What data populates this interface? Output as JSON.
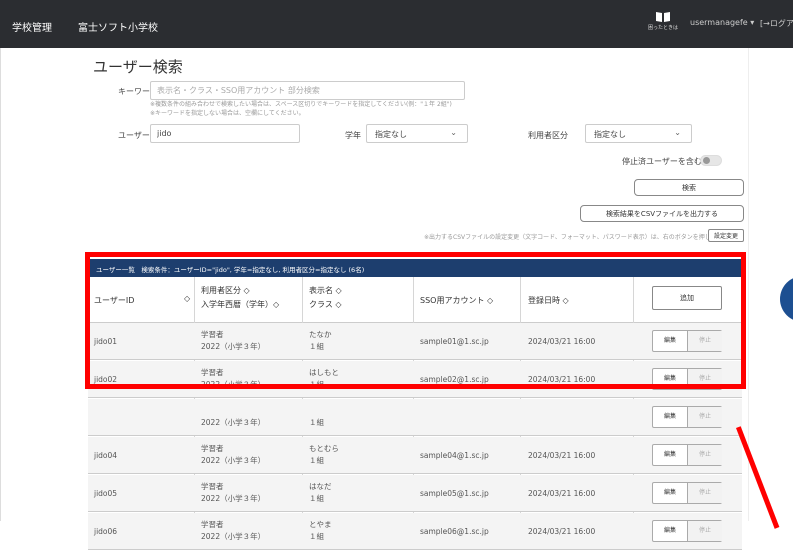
{
  "topbar": {
    "brand": "学校管理",
    "school": "富士ソフト小学校",
    "help_caption": "困ったときは",
    "user": "usermanagefe ▾",
    "logout": "[→ログアウ"
  },
  "page_title": "ユーザー検索",
  "search": {
    "keyword_label": "キーワード",
    "keyword_placeholder": "表示名・クラス・SSO用アカウント 部分検索",
    "keyword_note1": "※複数条件の組み合わせで検索したい場合は、スペース区切りでキーワードを指定してください(例：\"１年 2組\")",
    "keyword_note2": "※キーワードを指定しない場合は、空欄にしてください。",
    "userid_label": "ユーザーID",
    "userid_value": "jido",
    "grade_label": "学年",
    "grade_value": "指定なし",
    "type_label": "利用者区分",
    "type_value": "指定なし",
    "include_stopped_label": "停止済ユーザーを含む",
    "search_button": "検索",
    "csv_button": "検索結果をCSVファイルを出力する",
    "csv_note": "※出力するCSVファイルの設定変更（文字コード、フォーマット、パスワード表示）は、右のボタンを押してください。",
    "settings_button": "設定変更"
  },
  "table": {
    "header": "ユーザー一覧　検索条件：ユーザーID=\"jido\", 学年=指定なし, 利用者区分=指定なし (6名)",
    "col_userid": "ユーザーID",
    "col_type_line1": "利用者区分 ◇",
    "col_type_line2": "入学年西暦（学年）◇",
    "col_name_line1": "表示名 ◇",
    "col_name_line2": "クラス ◇",
    "col_sso": "SSO用アカウント ◇",
    "col_date": "登録日時 ◇",
    "add_button": "追加",
    "edit_label": "編集",
    "stop_label": "停止",
    "rows": [
      {
        "id": "jido01",
        "type": "学習者",
        "year": "2022（小学３年）",
        "name": "たなか",
        "cls": "１組",
        "sso": "sample01@1.sc.jp",
        "date": "2024/03/21 16:00"
      },
      {
        "id": "jido02",
        "type": "学習者",
        "year": "2022（小学３年）",
        "name": "はしもと",
        "cls": "１組",
        "sso": "sample02@1.sc.jp",
        "date": "2024/03/21 16:00"
      },
      {
        "id": "",
        "type": "",
        "year": "2022（小学３年）",
        "name": "",
        "cls": "１組",
        "sso": "",
        "date": ""
      },
      {
        "id": "jido04",
        "type": "学習者",
        "year": "2022（小学３年）",
        "name": "もとむら",
        "cls": "１組",
        "sso": "sample04@1.sc.jp",
        "date": "2024/03/21 16:00"
      },
      {
        "id": "jido05",
        "type": "学習者",
        "year": "2022（小学３年）",
        "name": "はなだ",
        "cls": "１組",
        "sso": "sample05@1.sc.jp",
        "date": "2024/03/21 16:00"
      },
      {
        "id": "jido06",
        "type": "学習者",
        "year": "2022（小学３年）",
        "name": "とやま",
        "cls": "１組",
        "sso": "sample06@1.sc.jp",
        "date": "2024/03/21 16:00"
      }
    ]
  },
  "colors": {
    "topbar": "#2b2d31",
    "table_header": "#1d3e6e",
    "highlight": "#ff0000"
  }
}
